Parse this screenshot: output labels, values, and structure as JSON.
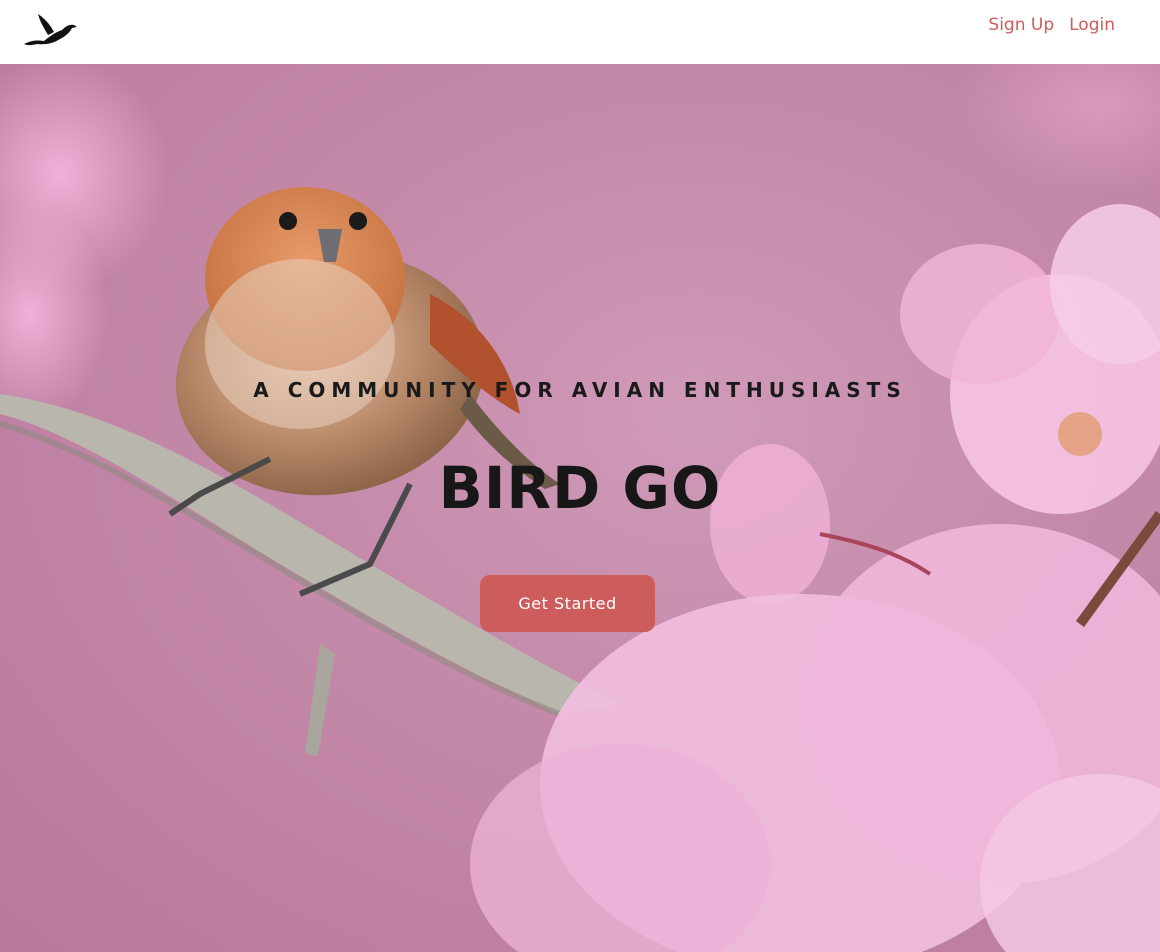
{
  "header": {
    "logo_icon": "bird-logo-icon",
    "nav": {
      "signup_label": "Sign Up",
      "login_label": "Login"
    }
  },
  "hero": {
    "background_image": "bird-on-cherry-blossom-branch",
    "tagline": "A COMMUNITY FOR AVIAN ENTHUSIASTS",
    "title": "BIRD GO",
    "cta_label": "Get Started"
  },
  "colors": {
    "accent": "#cd5c5c",
    "header_bg": "#ffffff",
    "title_text": "#171717"
  }
}
